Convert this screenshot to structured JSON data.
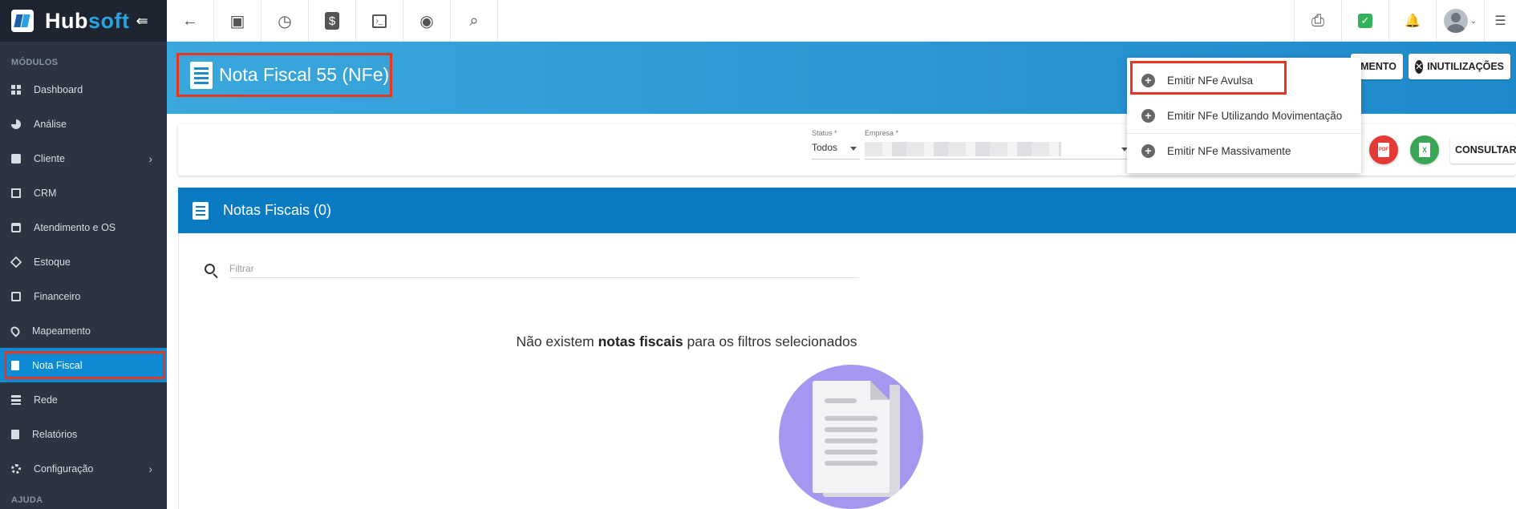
{
  "brand": {
    "name_part1": "Hub",
    "name_part2": "soft",
    "collapse_glyph": "⇚"
  },
  "sidebar": {
    "modules_label": "MÓDULOS",
    "help_label": "AJUDA",
    "items": [
      {
        "label": "Dashboard",
        "icon": "dashboard-icon"
      },
      {
        "label": "Análise",
        "icon": "pie-chart-icon"
      },
      {
        "label": "Cliente",
        "icon": "client-card-icon",
        "has_submenu": true
      },
      {
        "label": "CRM",
        "icon": "crm-board-icon"
      },
      {
        "label": "Atendimento e OS",
        "icon": "calendar-clock-icon"
      },
      {
        "label": "Estoque",
        "icon": "box-icon"
      },
      {
        "label": "Financeiro",
        "icon": "money-icon"
      },
      {
        "label": "Mapeamento",
        "icon": "map-pin-icon"
      },
      {
        "label": "Nota Fiscal",
        "icon": "document-icon",
        "active": true
      },
      {
        "label": "Rede",
        "icon": "network-icon"
      },
      {
        "label": "Relatórios",
        "icon": "report-icon"
      },
      {
        "label": "Configuração",
        "icon": "gear-icon",
        "has_submenu": true
      }
    ]
  },
  "topbar": {
    "left_icons": [
      "back-arrow-icon",
      "client-card-icon",
      "calendar-clock-icon",
      "dollar-icon",
      "terminal-icon",
      "eye-icon",
      "search-icon"
    ],
    "right_icons": [
      "pdf-icon",
      "green-check-icon",
      "bell-icon",
      "avatar",
      "list-icon"
    ],
    "glyphs": {
      "back": "←",
      "card": "▣",
      "calendar": "◷",
      "dollar": "$",
      "terminal": "›_",
      "eye": "◉",
      "search": "⌕",
      "pdf": "⎙",
      "check": "✓",
      "bell": "🔔",
      "list": "☰",
      "avatar_caret": "⌄"
    }
  },
  "header": {
    "title": "Nota Fiscal 55 (NFe)",
    "partial_button_label": "MENTO",
    "inutilizacoes_label": "INUTILIZAÇÕES",
    "close_glyph": "✕"
  },
  "dropdown": {
    "items": [
      {
        "label": "Emitir NFe Avulsa"
      },
      {
        "label": "Emitir NFe Utilizando Movimentação"
      },
      {
        "label": "Emitir NFe Massivamente"
      }
    ],
    "plus_glyph": "+"
  },
  "filters": {
    "status": {
      "label": "Status *",
      "value": "Todos"
    },
    "empresa": {
      "label": "Empresa *"
    },
    "consultar_label": "CONSULTAR",
    "pdf_glyph": "PDF",
    "excel_glyph": "X"
  },
  "notas": {
    "title": "Notas Fiscais (0)",
    "filter_placeholder": "Filtrar",
    "empty_prefix": "Não existem ",
    "empty_bold": "notas fiscais",
    "empty_suffix": " para os filtros selecionados"
  },
  "colors": {
    "sidebar_bg": "#2c3442",
    "active_item": "#0e89d4",
    "header_band": "#1f8acb",
    "panel_header": "#0a7bc2",
    "highlight_red": "#e5371f",
    "pdf_red": "#e53935",
    "excel_green": "#3aa655",
    "illustration_purple": "#a596ef"
  }
}
